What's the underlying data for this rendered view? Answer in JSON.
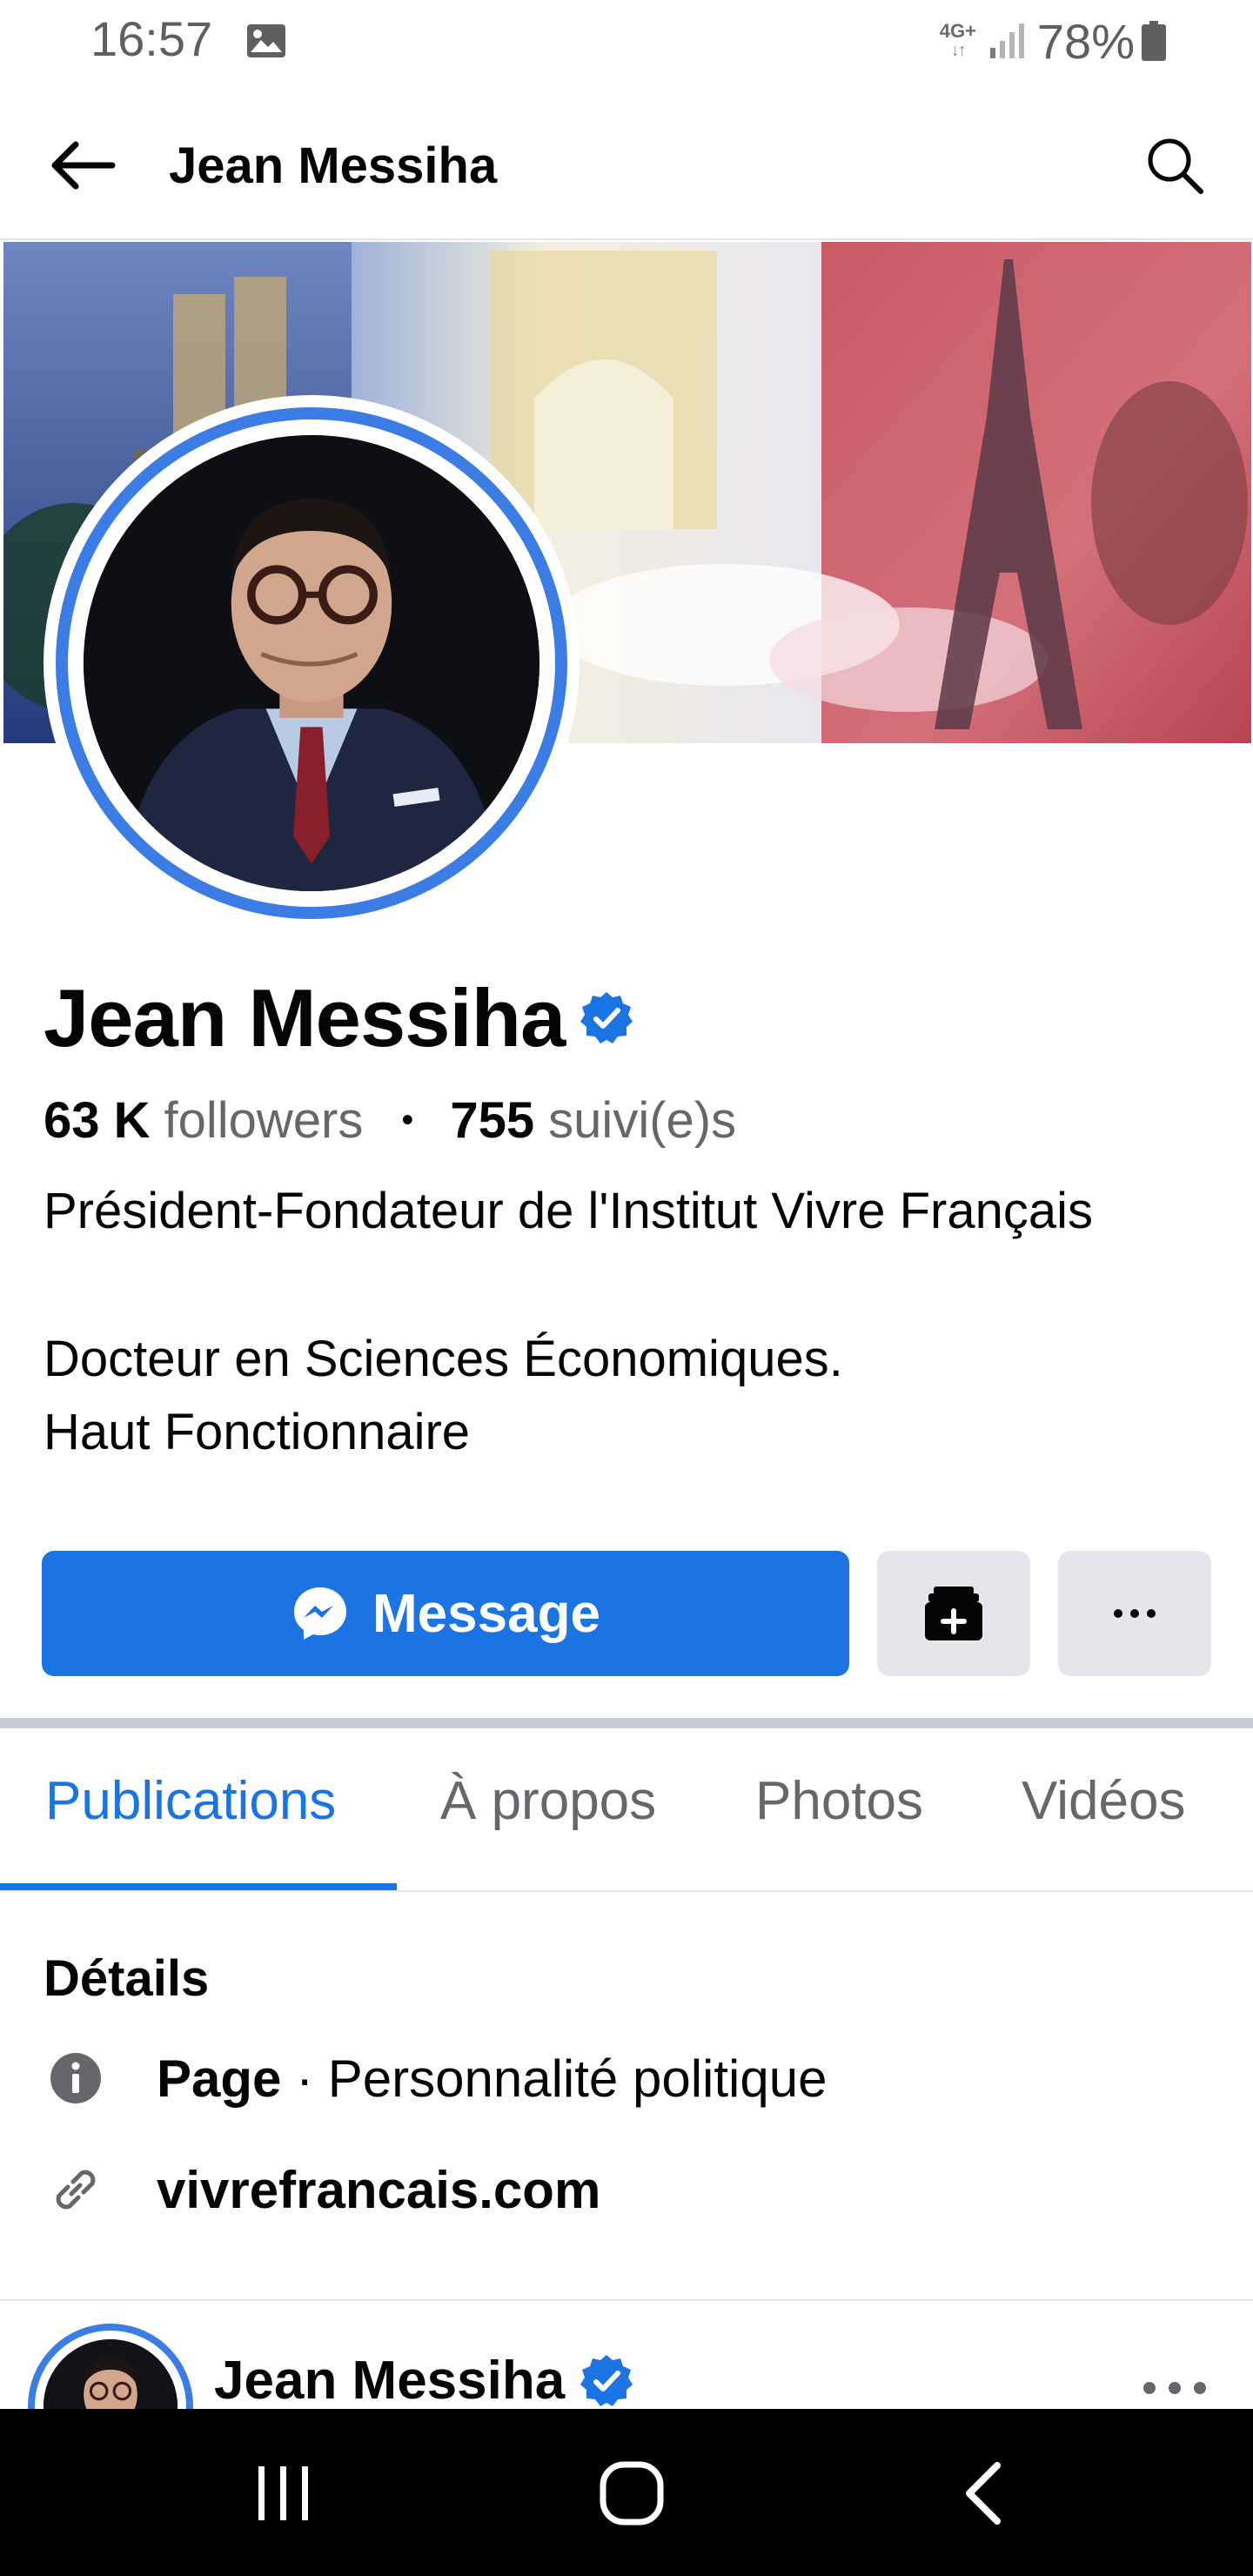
{
  "status_bar": {
    "time": "16:57",
    "network_type": "4G+",
    "network_arrows": "↓↑",
    "battery_percent": "78%",
    "icons": [
      "gallery-icon",
      "signal-icon",
      "battery-icon"
    ]
  },
  "app_bar": {
    "title": "Jean Messiha",
    "icons": [
      "back-arrow-icon",
      "search-icon"
    ]
  },
  "profile": {
    "name": "Jean Messiha",
    "verified": true,
    "followers_count": "63 K",
    "followers_label": "followers",
    "separator": "•",
    "following_count": "755",
    "following_label": "suivi(e)s",
    "bio_lines": [
      "Président-Fondateur de l'Institut Vivre Français",
      "",
      "Docteur en Sciences Économiques.",
      "Haut Fonctionnaire"
    ]
  },
  "actions": {
    "message_label": "Message",
    "icons": [
      "messenger-icon",
      "save-icon",
      "more-dots-icon"
    ]
  },
  "tabs": [
    {
      "label": "Publications",
      "active": true
    },
    {
      "label": "À propos",
      "active": false
    },
    {
      "label": "Photos",
      "active": false
    },
    {
      "label": "Vidéos",
      "active": false
    }
  ],
  "details": {
    "title": "Détails",
    "category_prefix": "Page",
    "category_separator": " · ",
    "category": "Personnalité politique",
    "website": "vivrefrancais.com"
  },
  "post": {
    "author": "Jean Messiha",
    "verified": true
  },
  "colors": {
    "accent": "#1b74e4",
    "ring": "#3b7de5",
    "secondary_text": "#65676b",
    "button_gray": "#e4e6eb"
  }
}
